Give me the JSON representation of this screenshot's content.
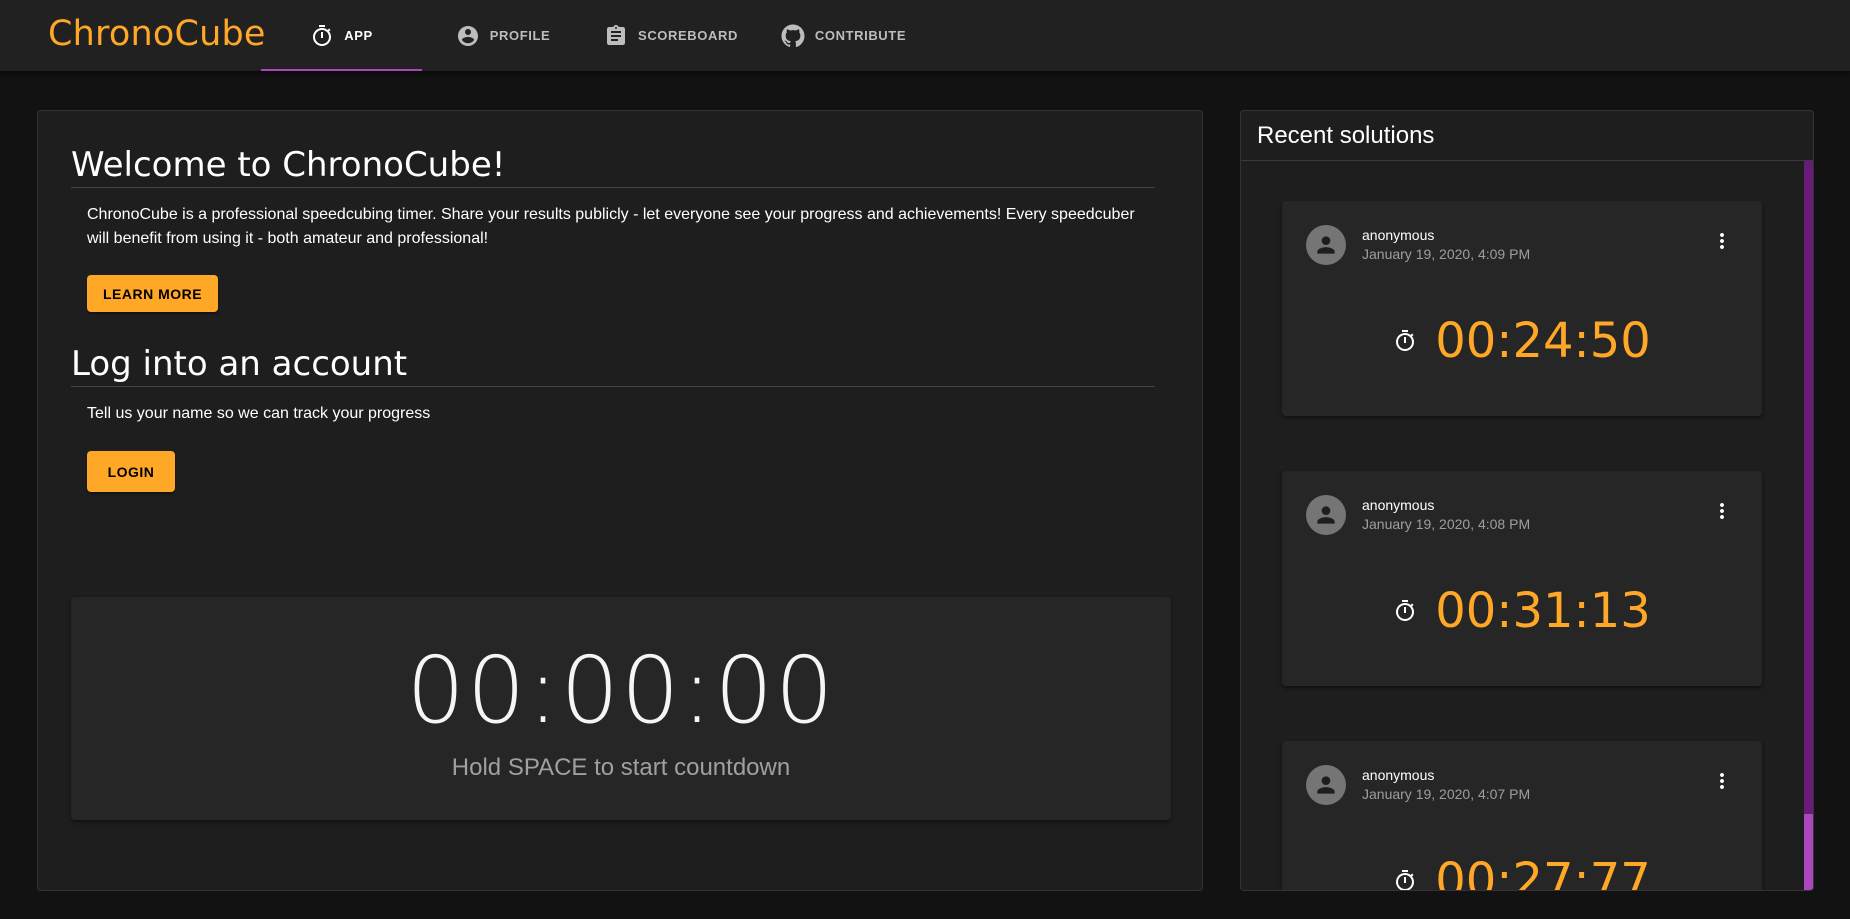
{
  "app": {
    "brand": "ChronoCube"
  },
  "nav": {
    "tabs": [
      {
        "label": "APP",
        "icon": "timer-icon",
        "active": true
      },
      {
        "label": "PROFILE",
        "icon": "account-circle-icon",
        "active": false
      },
      {
        "label": "SCOREBOARD",
        "icon": "assignment-icon",
        "active": false
      },
      {
        "label": "CONTRIBUTE",
        "icon": "github-icon",
        "active": false
      }
    ]
  },
  "welcome": {
    "title": "Welcome to ChronoCube!",
    "text": "ChronoCube is a professional speedcubing timer. Share your results publicly - let everyone see your progress and achievements! Every speedcuber will benefit from using it - both amateur and professional!",
    "button": "LEARN MORE"
  },
  "login": {
    "title": "Log into an account",
    "text": "Tell us your name so we can track your progress",
    "button": "LOGIN"
  },
  "timer": {
    "display": "00:00:00",
    "hint": "Hold SPACE to start countdown"
  },
  "recent": {
    "title": "Recent solutions",
    "items": [
      {
        "user": "anonymous",
        "date": "January 19, 2020, 4:09 PM",
        "time": "00:24:50"
      },
      {
        "user": "anonymous",
        "date": "January 19, 2020, 4:08 PM",
        "time": "00:31:13"
      },
      {
        "user": "anonymous",
        "date": "January 19, 2020, 4:07 PM",
        "time": "00:27:77"
      }
    ]
  },
  "colors": {
    "accent": "#ffa726",
    "tab_indicator": "#ab47bc",
    "background": "#121212",
    "surface": "#1e1e1e"
  }
}
